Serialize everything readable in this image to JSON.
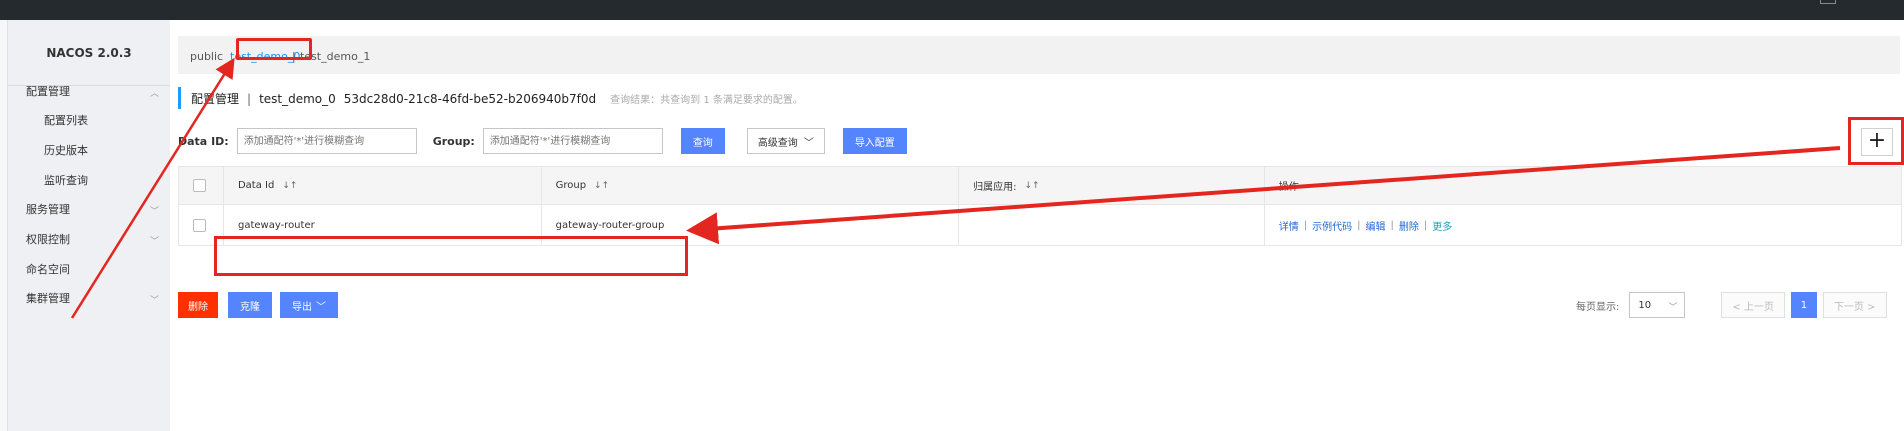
{
  "sidebar": {
    "brand": "NACOS 2.0.3",
    "items": [
      {
        "label": "配置管理",
        "chevron": "^"
      },
      {
        "label": "配置列表"
      },
      {
        "label": "历史版本"
      },
      {
        "label": "监听查询"
      },
      {
        "label": "服务管理",
        "chevron": "v"
      },
      {
        "label": "权限控制",
        "chevron": "v"
      },
      {
        "label": "命名空间"
      },
      {
        "label": "集群管理",
        "chevron": "v"
      }
    ]
  },
  "namespaces": {
    "items": [
      "public",
      "test_demo_0",
      "test_demo_1"
    ],
    "separator": "|"
  },
  "header": {
    "title": "配置管理",
    "separator": "|",
    "namespace": "test_demo_0",
    "namespace_id": "53dc28d0-21c8-46fd-be52-b206940b7f0d",
    "hint": "查询结果：共查询到 1 条满足要求的配置。"
  },
  "search": {
    "dataid_label": "Data ID:",
    "dataid_placeholder": "添加通配符'*'进行模糊查询",
    "group_label": "Group:",
    "group_placeholder": "添加通配符'*'进行模糊查询",
    "query_button": "查询",
    "advanced_button": "高级查询",
    "import_button": "导入配置",
    "add_button": "+"
  },
  "table": {
    "headers": [
      "Data Id",
      "Group",
      "归属应用:",
      "操作"
    ],
    "sort_glyph": "↓↑",
    "rows": [
      {
        "data_id": "gateway-router",
        "group": "gateway-router-group",
        "app": "",
        "ops": [
          "详情",
          "示例代码",
          "编辑",
          "删除",
          "更多"
        ]
      }
    ]
  },
  "actions": {
    "delete": "删除",
    "clone": "克隆",
    "export": "导出"
  },
  "pager": {
    "page_size_label": "每页显示:",
    "page_size": "10",
    "prev": "< 上一页",
    "current": "1",
    "next": "下一页 >"
  },
  "colors": {
    "primary": "#5584ff",
    "danger": "#ff3000",
    "annotation": "#e3261f",
    "link": "#1f68d6"
  }
}
